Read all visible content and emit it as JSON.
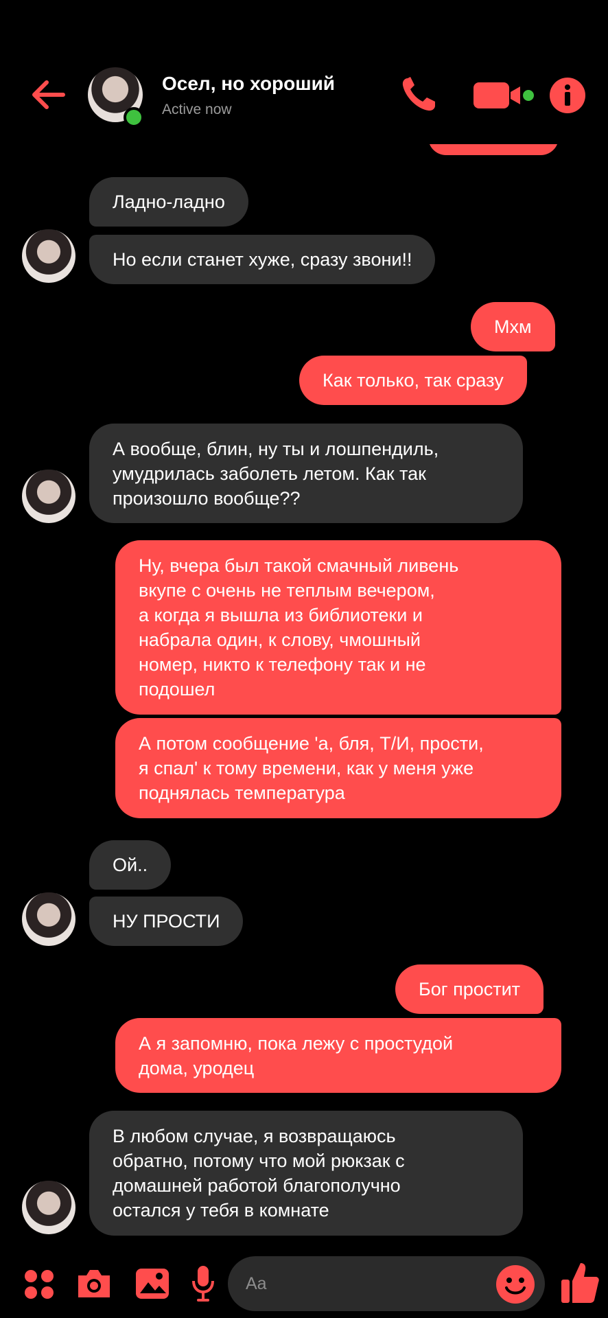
{
  "header": {
    "contact_name": "Осел, но хороший",
    "status": "Active now"
  },
  "messages": [
    {
      "side": "in",
      "text": "Ладно-ладно"
    },
    {
      "side": "in",
      "text": "Но если станет хуже, сразу звони!!"
    },
    {
      "side": "out",
      "text": "Мхм"
    },
    {
      "side": "out",
      "text": "Как только, так сразу"
    },
    {
      "side": "in",
      "text": "А вообще, блин, ну ты и лошпендиль,\nумудрилась заболеть летом. Как так\nпроизошло вообще??"
    },
    {
      "side": "out",
      "text": "Ну, вчера был такой смачный ливень\nвкупе с очень не теплым вечером,\nа когда я вышла из библиотеки и\nнабрала один, к слову, чмошный\nномер, никто к телефону так и не\nподошел"
    },
    {
      "side": "out",
      "text": "А потом сообщение 'а, бля, Т/И, прости,\nя спал' к тому времени, как у меня уже\nподнялась температура"
    },
    {
      "side": "in",
      "text": "Ой.."
    },
    {
      "side": "in",
      "text": "НУ ПРОСТИ"
    },
    {
      "side": "out",
      "text": "Бог простит"
    },
    {
      "side": "out",
      "text": "А я запомню, пока лежу с простудой\nдома, уродец"
    },
    {
      "side": "in",
      "text": "В любом случае, я возвращаюсь\nобратно, потому что мой рюкзак с\nдомашней работой  благополучно\nостался у тебя в комнате"
    }
  ],
  "composer": {
    "placeholder": "Aa",
    "icons": [
      "apps-icon",
      "camera-icon",
      "gallery-icon",
      "microphone-icon",
      "emoji-icon",
      "like-icon"
    ]
  },
  "colors": {
    "accent": "#ff4d4d",
    "incoming_bubble": "#303030",
    "background": "#000000",
    "online": "#3fc13f"
  }
}
